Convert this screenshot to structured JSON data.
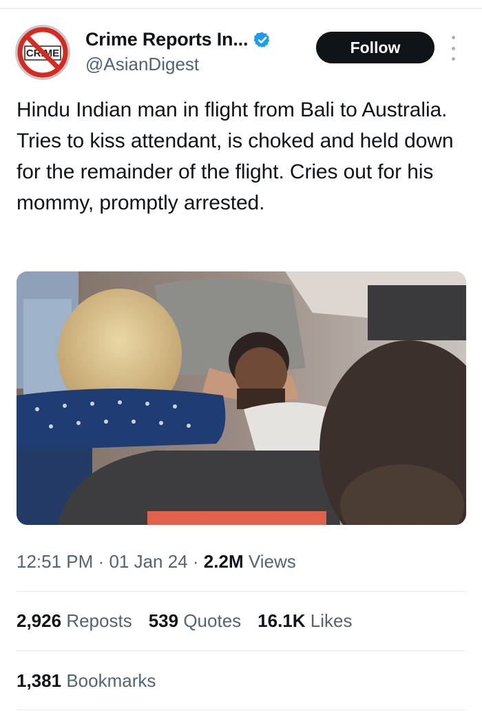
{
  "author": {
    "display_name": "Crime Reports In...",
    "handle": "@AsianDigest",
    "avatar_text": "CRIME",
    "verified": true
  },
  "actions": {
    "follow_label": "Follow"
  },
  "tweet": {
    "text": "Hindu Indian man in flight from Bali to Australia. Tries to kiss attendant, is choked and held down for the remainder of the flight. Cries out for his mommy, promptly arrested."
  },
  "meta": {
    "time": "12:51 PM",
    "date": "01 Jan 24",
    "views_count": "2.2M",
    "views_label": "Views",
    "separator": "·"
  },
  "stats": {
    "reposts_count": "2,926",
    "reposts_label": "Reposts",
    "quotes_count": "539",
    "quotes_label": "Quotes",
    "likes_count": "16.1K",
    "likes_label": "Likes",
    "bookmarks_count": "1,381",
    "bookmarks_label": "Bookmarks"
  },
  "colors": {
    "text_primary": "#0f1419",
    "text_secondary": "#536471",
    "verified_blue": "#1d9bf0",
    "follow_bg": "#0f1419",
    "divider": "#e6e9eb"
  }
}
